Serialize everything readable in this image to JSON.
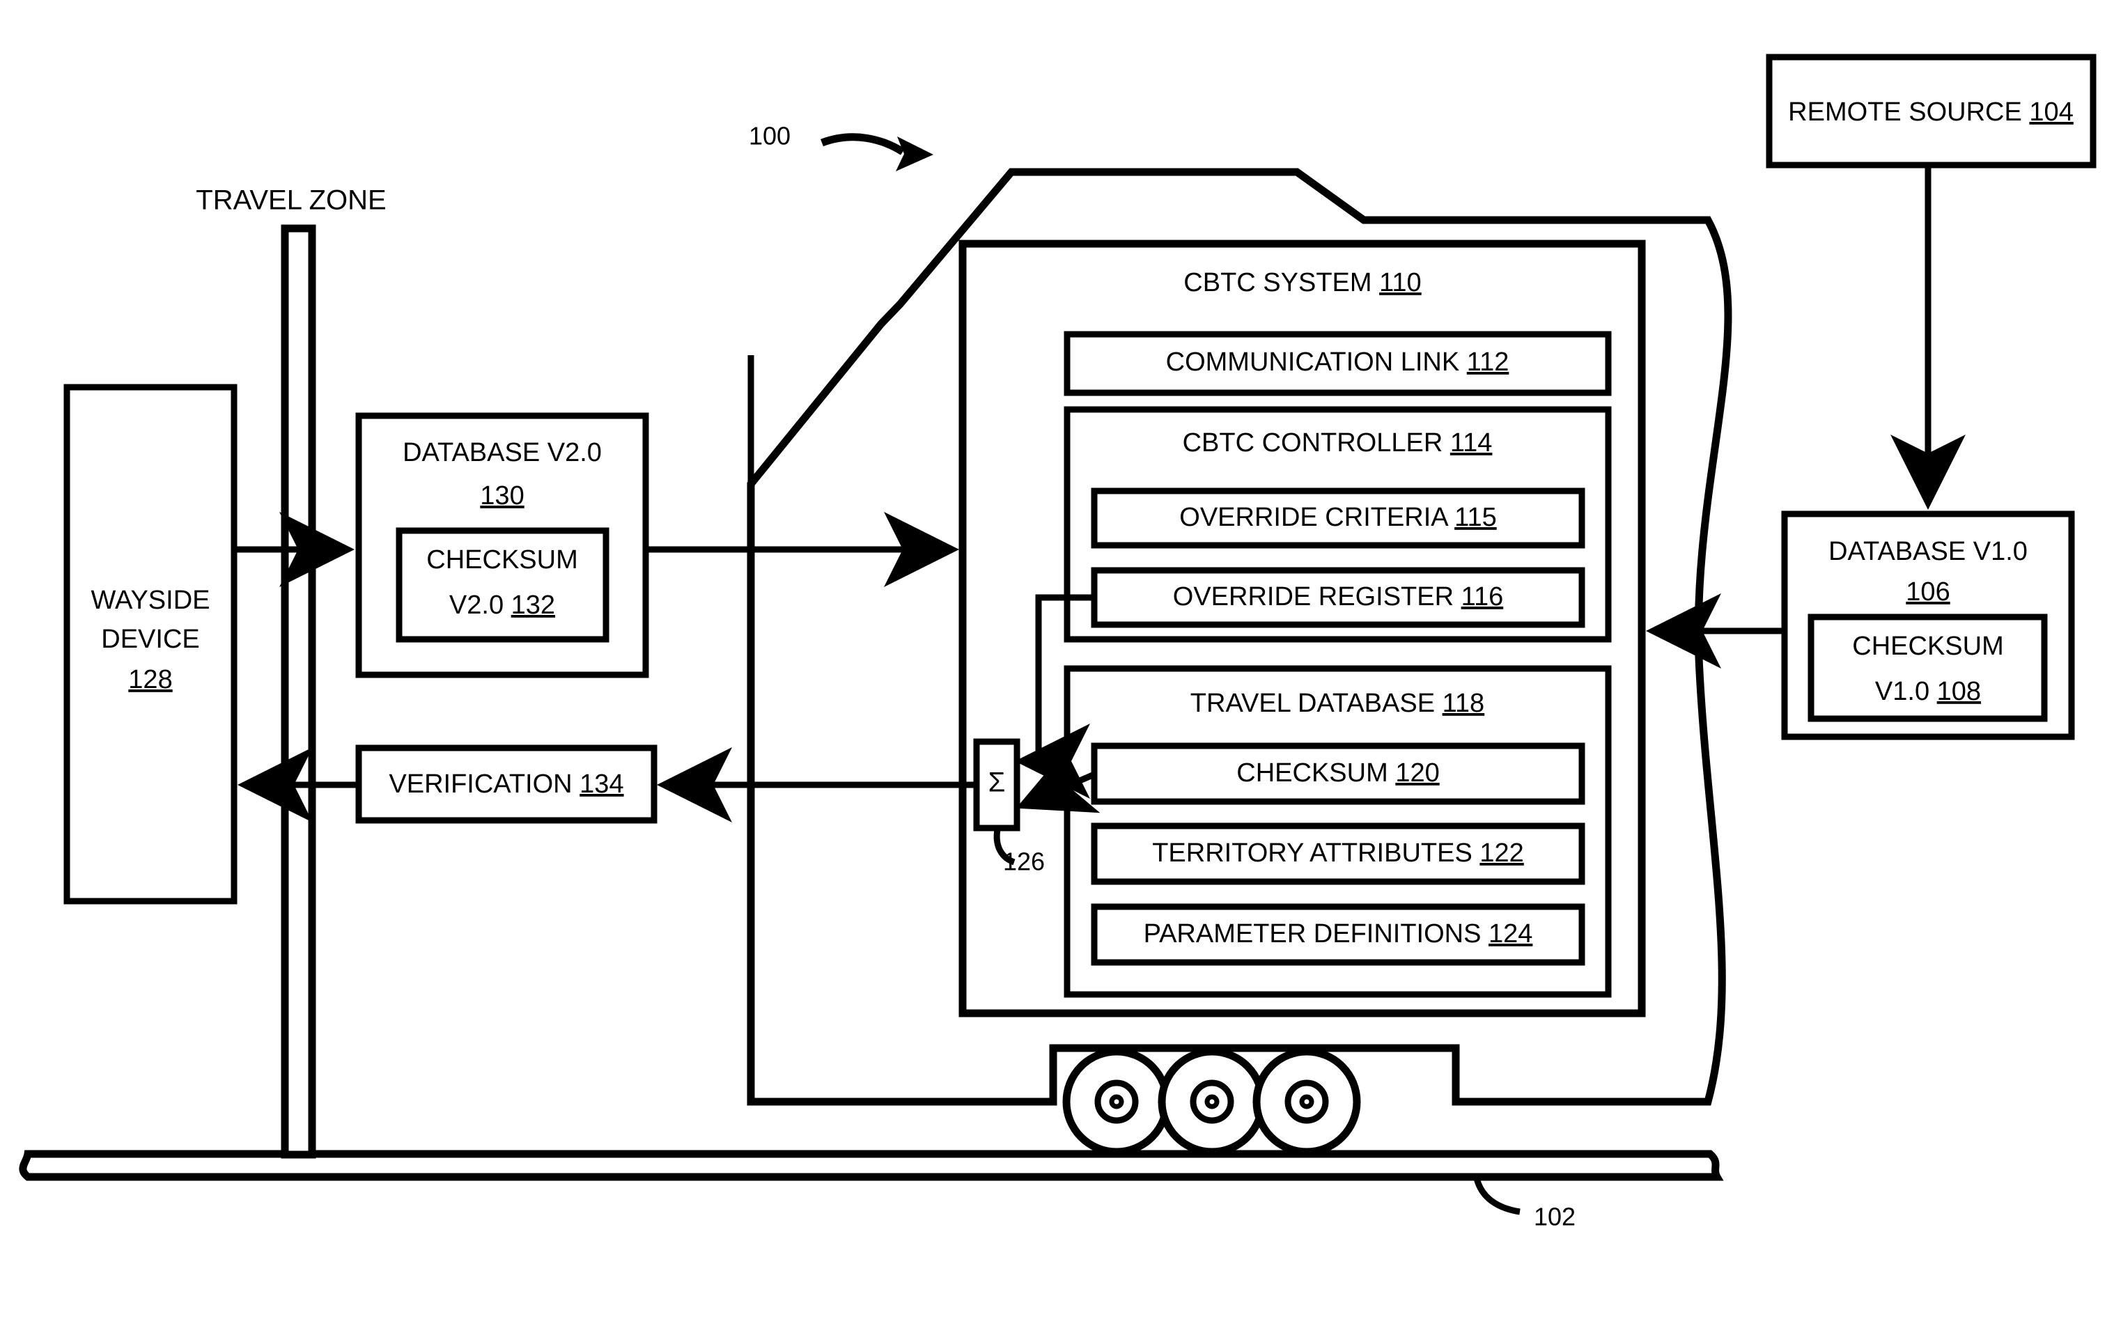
{
  "figure": {
    "ref_system": "100",
    "ref_track": "102",
    "ref_sum_node": "126",
    "sum_symbol": "Σ"
  },
  "travel_zone": {
    "label": "TRAVEL ZONE"
  },
  "wayside_device": {
    "line1": "WAYSIDE",
    "line2": "DEVICE",
    "ref": "128"
  },
  "database_v2": {
    "title": "DATABASE V2.0",
    "ref": "130",
    "checksum": {
      "line1": "CHECKSUM",
      "line2": "V2.0",
      "ref": "132"
    }
  },
  "verification": {
    "label": "VERIFICATION",
    "ref": "134"
  },
  "remote_source": {
    "label": "REMOTE SOURCE",
    "ref": "104"
  },
  "database_v1": {
    "title": "DATABASE V1.0",
    "ref": "106",
    "checksum": {
      "line1": "CHECKSUM",
      "line2": "V1.0",
      "ref": "108"
    }
  },
  "cbtc_system": {
    "title": "CBTC SYSTEM",
    "ref": "110",
    "communication_link": {
      "label": "COMMUNICATION LINK",
      "ref": "112"
    },
    "controller": {
      "title": "CBTC CONTROLLER",
      "ref": "114",
      "override_criteria": {
        "label": "OVERRIDE CRITERIA",
        "ref": "115"
      },
      "override_register": {
        "label": "OVERRIDE REGISTER",
        "ref": "116"
      }
    },
    "travel_database": {
      "title": "TRAVEL DATABASE",
      "ref": "118",
      "checksum": {
        "label": "CHECKSUM",
        "ref": "120"
      },
      "territory_attributes": {
        "label": "TERRITORY ATTRIBUTES",
        "ref": "122"
      },
      "parameter_definitions": {
        "label": "PARAMETER DEFINITIONS",
        "ref": "124"
      }
    }
  },
  "colors": {
    "ink": "#000000",
    "paper": "#ffffff"
  }
}
